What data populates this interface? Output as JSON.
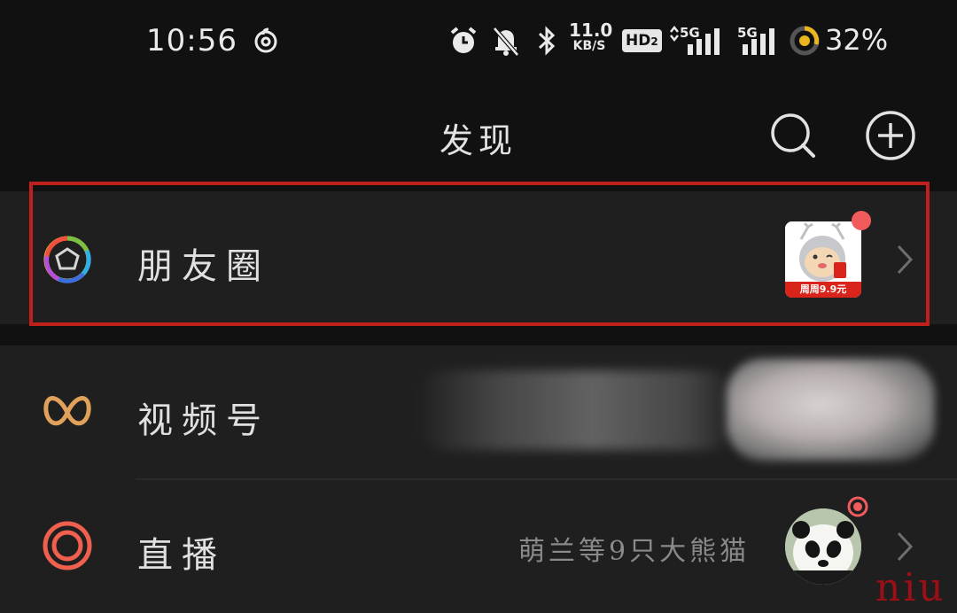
{
  "status_bar": {
    "time": "10:56",
    "net_speed_value": "11.0",
    "net_speed_unit": "KB/S",
    "hd_label": "HD",
    "hd_sub": "2",
    "signal_1_label": "5G",
    "signal_2_label": "5G",
    "battery_percent": "32%"
  },
  "header": {
    "title": "发现"
  },
  "items": [
    {
      "label": "朋友圈",
      "thumbnail_caption": "周周9.9元",
      "has_red_dot": true
    },
    {
      "label": "视频号"
    },
    {
      "label": "直播",
      "subtitle": "萌兰等9只大熊猫",
      "has_live_dot": true
    }
  ],
  "watermark": "niu",
  "colors": {
    "background": "#111111",
    "row_background": "#1f1f1f",
    "highlight_border": "#c0201c",
    "channels_icon": "#e0a15a",
    "live_icon": "#f0604e",
    "badge_red": "#f25b5b"
  },
  "icons": [
    "netease-music-icon",
    "alarm-icon",
    "mute-bell-icon",
    "bluetooth-icon",
    "signal-icon",
    "battery-ring-icon",
    "search-icon",
    "plus-circle-icon",
    "moments-shutter-icon",
    "channels-icon",
    "live-icon",
    "chevron-right-icon"
  ]
}
